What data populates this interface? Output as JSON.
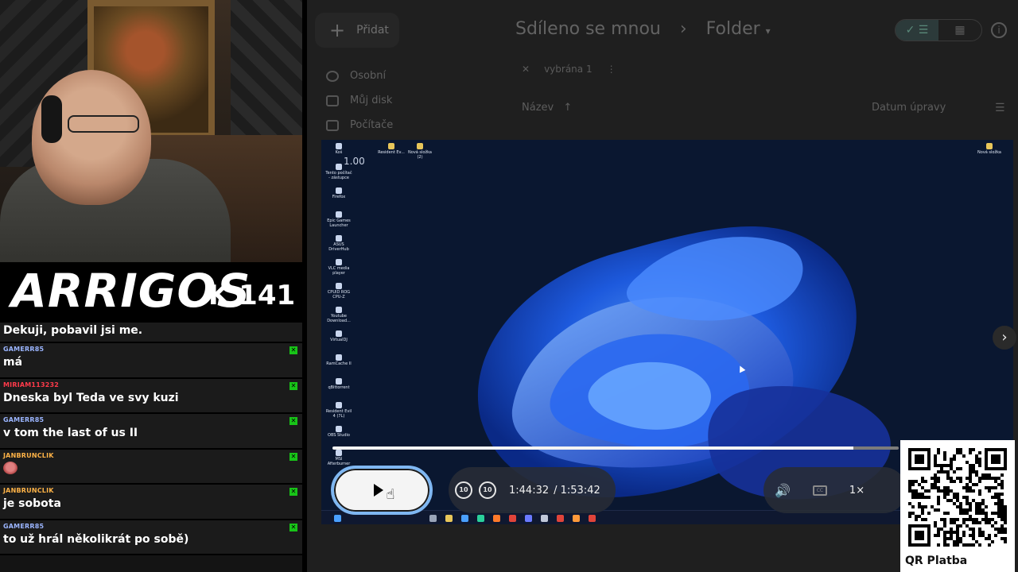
{
  "overlay": {
    "logo_main": "ARRIGOS",
    "logo_sub": "K 141",
    "chat": {
      "top_message": "Dekuji, pobavil jsi me.",
      "messages": [
        {
          "user": "GAMERR85",
          "user_color": "#9bb5ff",
          "text": "má",
          "emote": false
        },
        {
          "user": "MIRIAM113232",
          "user_color": "#ff3a4a",
          "text": "Dneska byl Teda ve svy kuzi",
          "emote": false
        },
        {
          "user": "GAMERR85",
          "user_color": "#9bb5ff",
          "text": "v tom the last of us II",
          "emote": false
        },
        {
          "user": "JANBRUNCLIK",
          "user_color": "#ffb347",
          "text": "",
          "emote": true
        },
        {
          "user": "JANBRUNCLIK",
          "user_color": "#ffb347",
          "text": "je sobota",
          "emote": false
        },
        {
          "user": "GAMERR85",
          "user_color": "#9bb5ff",
          "text": "to už hrál několikrát po sobě)",
          "emote": false
        }
      ]
    }
  },
  "drive": {
    "add_label": "Přidat",
    "nav": [
      "Osobní",
      "Můj disk",
      "Počítače"
    ],
    "breadcrumb": {
      "parent": "Sdíleno se mnou",
      "separator": "›",
      "current": "Folder"
    },
    "selection_text": "vybrána 1",
    "columns": {
      "name": "Název",
      "modified": "Datum úpravy"
    }
  },
  "video": {
    "speed_overlay": "1.00",
    "desktop_icons_top": [
      "Koš",
      "Resident Ev...",
      "Nová složka (2)"
    ],
    "desktop_icons_left": [
      "Tento počítač - zástupce",
      "Firefox",
      "Epic Games Launcher",
      "ASUS DriverHub",
      "VLC media player",
      "CPUID ROG CPU-Z",
      "Youtube Download...",
      "VirtualDJ",
      "RamCache II",
      "qBittorrent",
      "Resident Evil 4 (7L)",
      "OBS Studio",
      "MSI Afterburner"
    ],
    "desktop_icon_right": "Nová složka",
    "progress_fraction": 0.92,
    "time_current": "1:44:32",
    "time_total": "/ 1:53:42",
    "speed_button": "1×",
    "skip_back": "10",
    "skip_forward": "10",
    "cc_label": "CC"
  },
  "qr": {
    "label": "QR Platba"
  }
}
